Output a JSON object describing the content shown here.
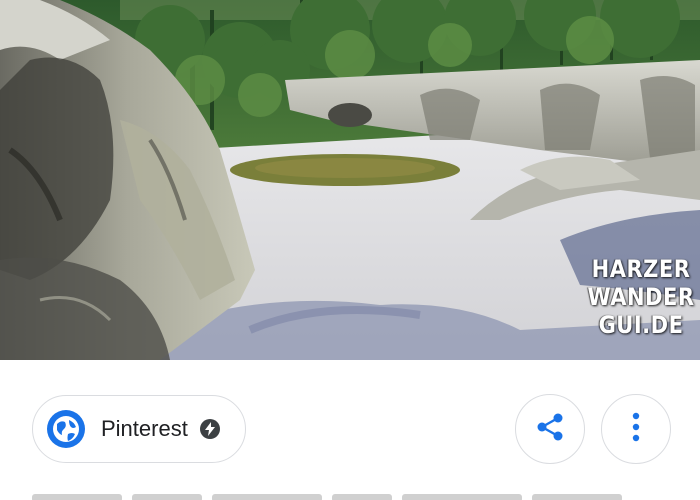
{
  "image": {
    "watermark": {
      "line1": "HARZER",
      "line2": "WANDER",
      "line3": "GUI.DE"
    }
  },
  "source": {
    "site_name": "Pinterest",
    "site_icon": "globe-icon",
    "badge_icon": "amp-lightning-icon"
  },
  "actions": {
    "share_icon": "share-icon",
    "more_icon": "more-vert-icon"
  },
  "colors": {
    "accent": "#1a73e8",
    "chip_border": "#dadce0",
    "text": "#202124"
  }
}
